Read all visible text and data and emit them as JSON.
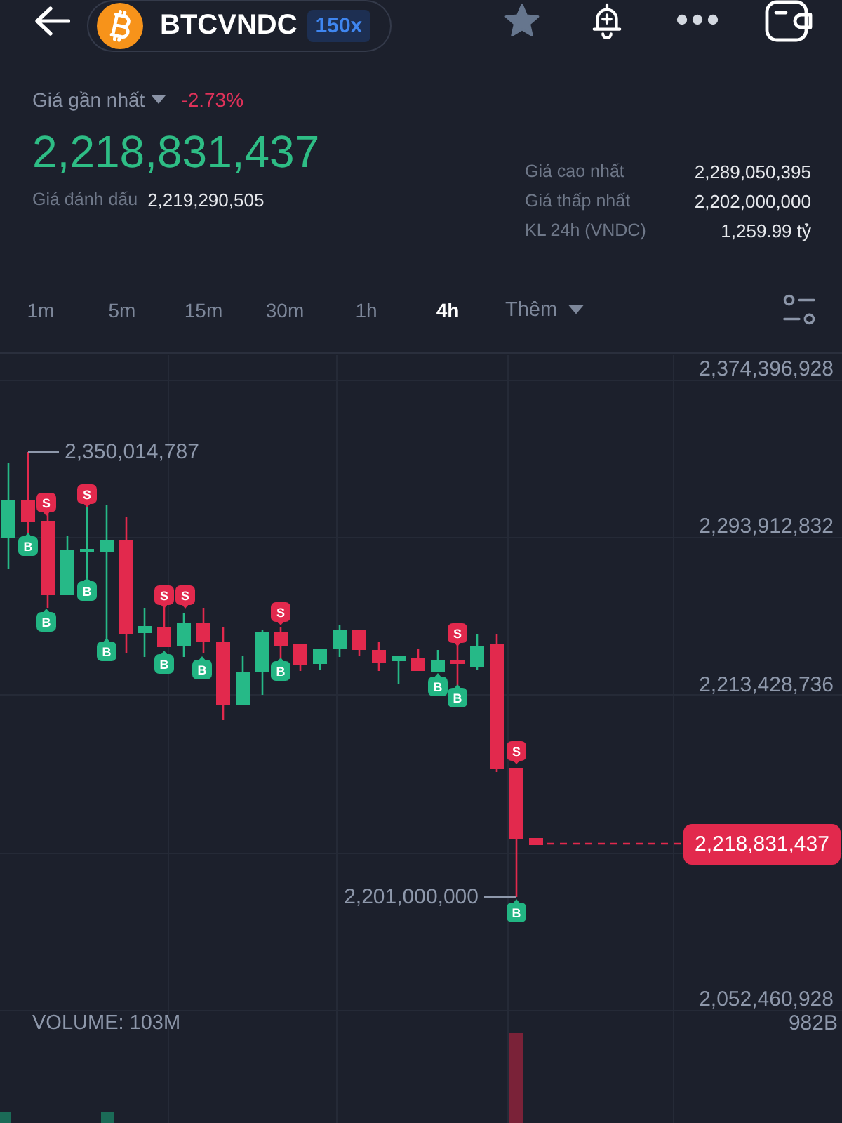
{
  "header": {
    "symbol": "BTCVNDC",
    "leverage": "150x"
  },
  "price": {
    "label": "Giá gần nhất",
    "change": "-2.73%",
    "last": "2,218,831,437",
    "mark_label": "Giá đánh dấu",
    "mark_value": "2,219,290,505"
  },
  "stats": [
    {
      "label": "Giá cao nhất",
      "value": "2,289,050,395"
    },
    {
      "label": "Giá thấp nhất",
      "value": "2,202,000,000"
    },
    {
      "label": "KL 24h (VNDC)",
      "value": "1,259.99 tỷ"
    }
  ],
  "timeframes": [
    {
      "label": "1m",
      "selected": false
    },
    {
      "label": "5m",
      "selected": false
    },
    {
      "label": "15m",
      "selected": false
    },
    {
      "label": "30m",
      "selected": false
    },
    {
      "label": "1h",
      "selected": false
    },
    {
      "label": "4h",
      "selected": true
    }
  ],
  "more_timeframes": {
    "label": "Thêm"
  },
  "chart": {
    "price_axis": [
      "2,374,396,928",
      "2,293,912,832",
      "2,213,428,736",
      "2,052,460,928"
    ],
    "high_label": "2,350,014,787",
    "low_label": "2,201,000,000",
    "current_price": "2,218,831,437",
    "markers": [
      {
        "kind": "buy",
        "label": "B"
      },
      {
        "kind": "sell",
        "label": "S"
      },
      {
        "kind": "buy",
        "label": "B"
      },
      {
        "kind": "sell",
        "label": "S"
      },
      {
        "kind": "buy",
        "label": "B"
      },
      {
        "kind": "buy",
        "label": "B"
      },
      {
        "kind": "sell",
        "label": "S"
      },
      {
        "kind": "buy",
        "label": "B"
      },
      {
        "kind": "sell",
        "label": "S"
      },
      {
        "kind": "buy",
        "label": "B"
      },
      {
        "kind": "sell",
        "label": "S"
      },
      {
        "kind": "buy",
        "label": "B"
      },
      {
        "kind": "buy",
        "label": "B"
      },
      {
        "kind": "sell",
        "label": "S"
      },
      {
        "kind": "buy",
        "label": "B"
      },
      {
        "kind": "sell",
        "label": "S"
      },
      {
        "kind": "buy",
        "label": "B"
      }
    ],
    "volume_label": "VOLUME: 103M",
    "volume_axis": "982B"
  }
}
